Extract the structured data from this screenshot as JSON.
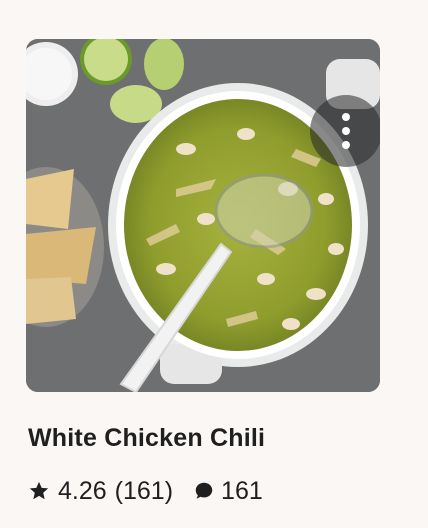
{
  "recipe": {
    "title": "White Chicken Chili",
    "rating": "4.26",
    "rating_count": "(161)",
    "comment_count": "161",
    "image_icon": "soup-pot-photo",
    "menu_icon": "more-vertical-icon"
  },
  "colors": {
    "background": "#fbf7f5",
    "text": "#1f1f1f",
    "menu_bg": "#3a3a3a"
  }
}
